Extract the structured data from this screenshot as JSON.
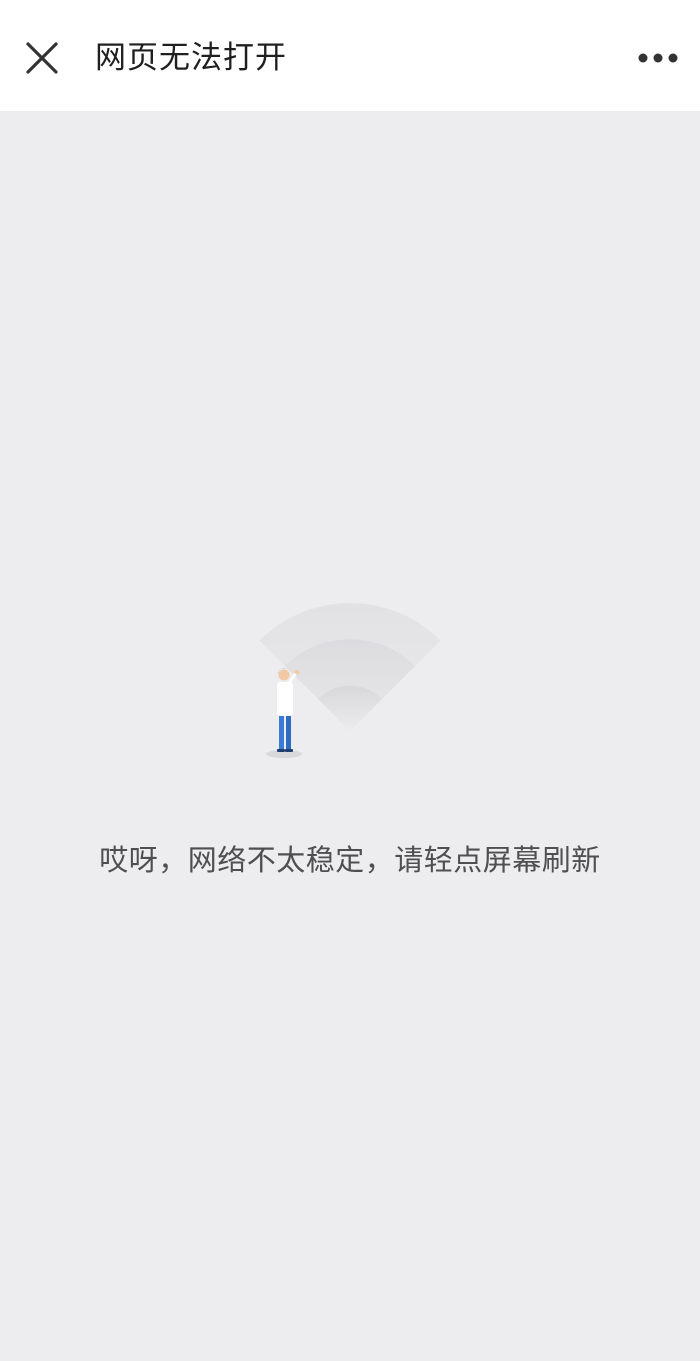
{
  "navbar": {
    "title": "网页无法打开",
    "close_icon": "close-icon",
    "more_icon": "more-options-icon"
  },
  "main": {
    "illustration": "weak-wifi-signal-person-illustration",
    "message": "哎呀，网络不太稳定，请轻点屏幕刷新"
  },
  "colors": {
    "navbar_background": "#ffffff",
    "page_background": "#ededf0",
    "title_text": "#1f1f1f",
    "message_text": "#4f4f4f",
    "person_shirt": "#ffffff",
    "person_pants": "#3a7bd5"
  }
}
